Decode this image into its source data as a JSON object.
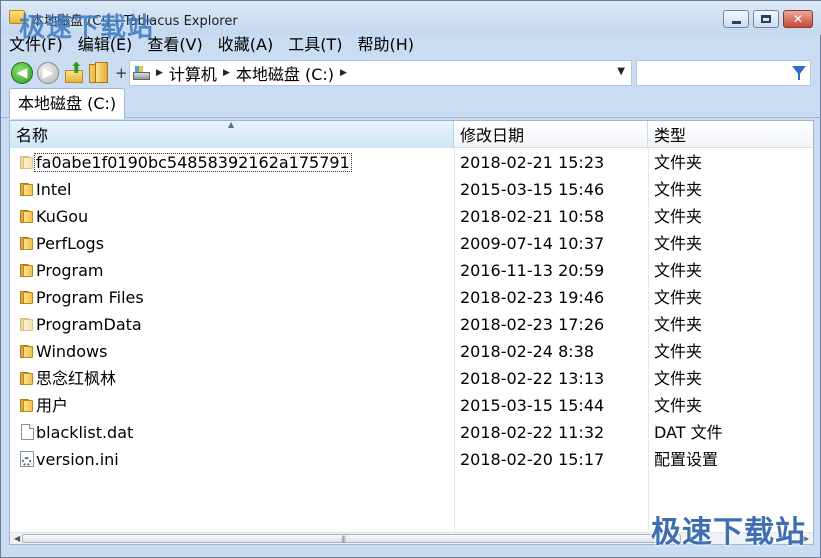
{
  "window": {
    "title": "本地磁盘 (C:) - Tablacus Explorer",
    "watermark": "极速下载站"
  },
  "menu": [
    "文件(F)",
    "编辑(E)",
    "查看(V)",
    "收藏(A)",
    "工具(T)",
    "帮助(H)"
  ],
  "toolbar": {
    "add_label": "+"
  },
  "address": {
    "crumbs": [
      "计算机",
      "本地磁盘 (C:)"
    ]
  },
  "search": {
    "value": ""
  },
  "tabs": [
    {
      "label": "本地磁盘 (C:)"
    }
  ],
  "columns": {
    "name": "名称",
    "date": "修改日期",
    "type": "类型"
  },
  "files": [
    {
      "name": "fa0abe1f0190bc54858392162a175791",
      "date": "2018-02-21 15:23",
      "type": "文件夹",
      "icon": "folder-icon"
    },
    {
      "name": "Intel",
      "date": "2015-03-15 15:46",
      "type": "文件夹",
      "icon": "folder-icon"
    },
    {
      "name": "KuGou",
      "date": "2018-02-21 10:58",
      "type": "文件夹",
      "icon": "folder-icon"
    },
    {
      "name": "PerfLogs",
      "date": "2009-07-14 10:37",
      "type": "文件夹",
      "icon": "folder-icon"
    },
    {
      "name": "Program",
      "date": "2016-11-13 20:59",
      "type": "文件夹",
      "icon": "folder-icon"
    },
    {
      "name": "Program Files",
      "date": "2018-02-23 19:46",
      "type": "文件夹",
      "icon": "folder-icon"
    },
    {
      "name": "ProgramData",
      "date": "2018-02-23 17:26",
      "type": "文件夹",
      "icon": "folder-icon"
    },
    {
      "name": "Windows",
      "date": "2018-02-24 8:38",
      "type": "文件夹",
      "icon": "folder-icon"
    },
    {
      "name": "思念红枫林",
      "date": "2018-02-22 13:13",
      "type": "文件夹",
      "icon": "folder-icon"
    },
    {
      "name": "用户",
      "date": "2015-03-15 15:44",
      "type": "文件夹",
      "icon": "folder-icon"
    },
    {
      "name": "blacklist.dat",
      "date": "2018-02-22 11:32",
      "type": "DAT 文件",
      "icon": "file-icon"
    },
    {
      "name": "version.ini",
      "date": "2018-02-20 15:17",
      "type": "配置设置",
      "icon": "settings-file-icon"
    }
  ]
}
